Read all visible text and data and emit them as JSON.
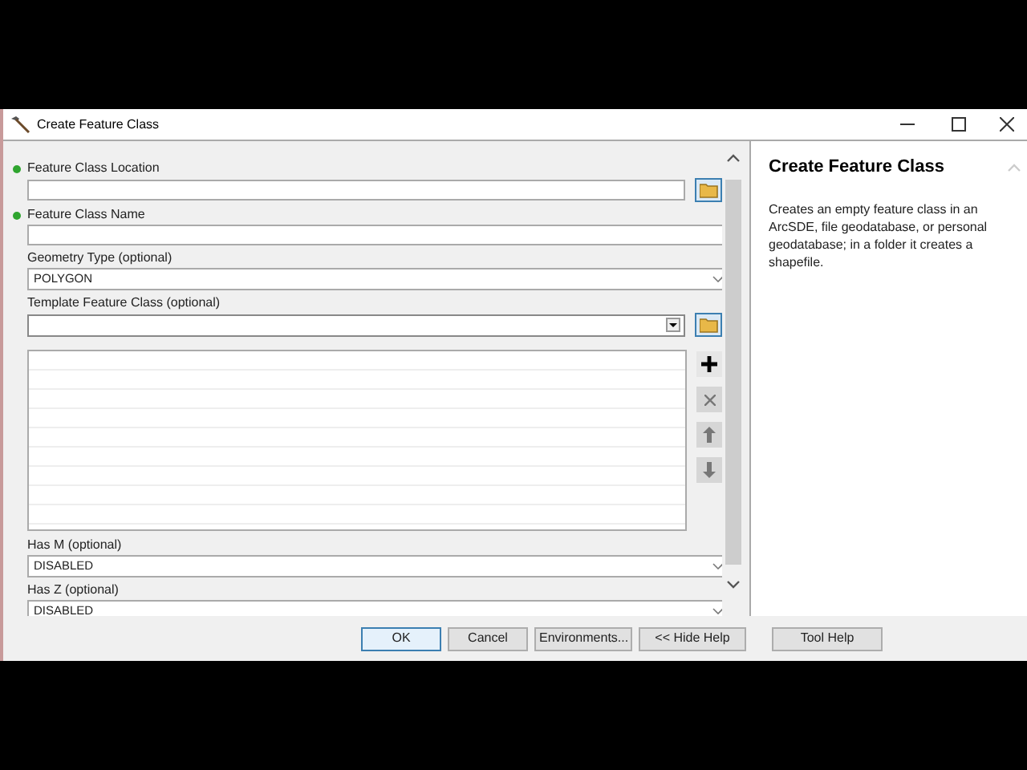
{
  "window": {
    "title": "Create Feature Class"
  },
  "parameters": [
    {
      "kind": "path",
      "label": "Feature Class Location",
      "required": true
    },
    {
      "kind": "text",
      "label": "Feature Class Name",
      "required": true
    },
    {
      "kind": "select",
      "label": "Geometry Type (optional)",
      "required": false,
      "value": "POLYGON"
    },
    {
      "kind": "combo_path",
      "label": "Template Feature Class (optional)",
      "required": false
    },
    {
      "kind": "list"
    },
    {
      "kind": "select",
      "label": "Has M (optional)",
      "required": false,
      "value": "DISABLED"
    },
    {
      "kind": "select",
      "label": "Has Z (optional)",
      "required": false,
      "value": "DISABLED"
    }
  ],
  "help": {
    "title": "Create Feature Class",
    "body": "Creates an empty feature class in an ArcSDE, file geodatabase, or personal geodatabase; in a folder it creates a shapefile."
  },
  "buttons": [
    {
      "label": "OK",
      "default": true
    },
    {
      "label": "Cancel",
      "default": false
    },
    {
      "label": "Environments...",
      "default": false
    },
    {
      "label": "<< Hide Help",
      "default": false
    },
    {
      "label": "Tool Help",
      "default": false
    }
  ]
}
